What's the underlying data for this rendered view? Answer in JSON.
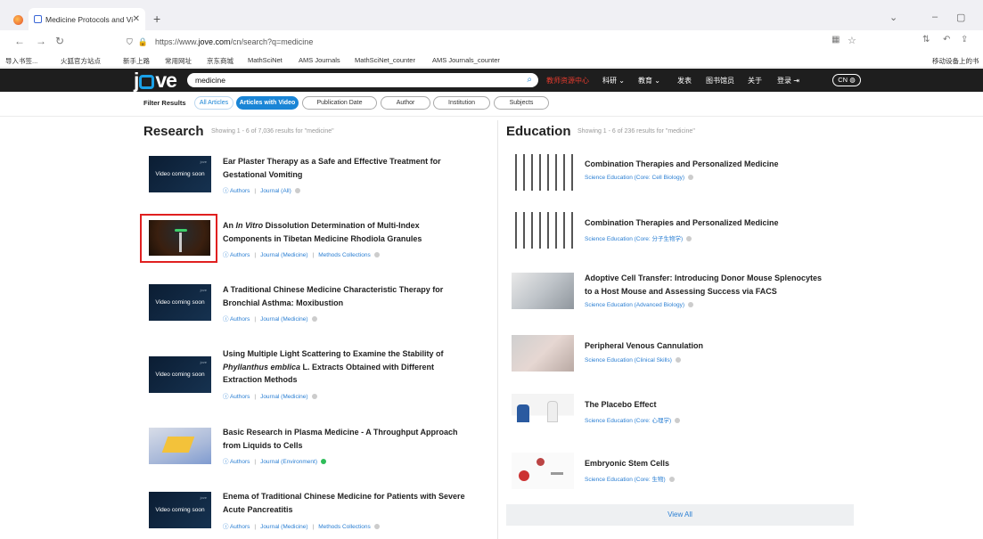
{
  "browser": {
    "tab_title": "Medicine Protocols and Vid",
    "url_prefix": "https://www.",
    "url_domain": "jove.com",
    "url_path": "/cn/search?q=medicine",
    "bookmarks": [
      "导入书签...",
      "火狐官方站点",
      "新手上路",
      "常用网址",
      "京东商城",
      "MathSciNet",
      "AMS Journals",
      "MathSciNet_counter",
      "AMS Journals_counter"
    ],
    "bookmarks_right": "移动设备上的书"
  },
  "header": {
    "logo_j": "j",
    "logo_ve": "ve",
    "search_value": "medicine",
    "nav": [
      "教师资源中心",
      "科研 ⌄",
      "教育 ⌄",
      "发表",
      "图书馆员",
      "关于",
      "登录"
    ],
    "lang": "CN"
  },
  "filters": {
    "label": "Filter Results",
    "buttons": [
      "All Articles",
      "Articles with Video",
      "Publication Date",
      "Author",
      "Institution",
      "Subjects"
    ]
  },
  "research": {
    "title": "Research",
    "subtitle": "Showing 1 - 6 of 7,036 results for \"medicine\"",
    "video_soon": "Video coming soon",
    "items": [
      {
        "title_l1": "Ear Plaster Therapy as a Safe and Effective Treatment for",
        "title_l2": "Gestational Vomiting",
        "authors": "Authors",
        "journal": "Journal (All)",
        "extra": ""
      },
      {
        "title_pre": "An ",
        "title_em": "In Vitro",
        "title_post": " Dissolution Determination of Multi-Index",
        "title_l2": "Components in Tibetan Medicine Rhodiola Granules",
        "authors": "Authors",
        "journal": "Journal (Medicine)",
        "extra": "Methods Collections"
      },
      {
        "title_l1": "A Traditional Chinese Medicine Characteristic Therapy for",
        "title_l2": "Bronchial Asthma: Moxibustion",
        "authors": "Authors",
        "journal": "Journal (Medicine)",
        "extra": ""
      },
      {
        "title_l1": "Using Multiple Light Scattering to Examine the Stability of",
        "title_em": "Phyllanthus emblica",
        "title_post": " L. Extracts Obtained with Different",
        "title_l3": "Extraction Methods",
        "authors": "Authors",
        "journal": "Journal (Medicine)",
        "extra": ""
      },
      {
        "title_l1": "Basic Research in Plasma Medicine - A Throughput Approach",
        "title_l2": "from Liquids to Cells",
        "authors": "Authors",
        "journal": "Journal (Environment)",
        "extra": ""
      },
      {
        "title_l1": "Enema of Traditional Chinese Medicine for Patients with Severe",
        "title_l2": "Acute Pancreatitis",
        "authors": "Authors",
        "journal": "Journal (Medicine)",
        "extra": "Methods Collections"
      }
    ]
  },
  "education": {
    "title": "Education",
    "subtitle": "Showing 1 - 6 of 236 results for \"medicine\"",
    "items": [
      {
        "title": "Combination Therapies and Personalized Medicine",
        "meta": "Science Education (Core: Cell Biology)"
      },
      {
        "title": "Combination Therapies and Personalized Medicine",
        "meta": "Science Education (Core: 分子生物学)"
      },
      {
        "title_l1": "Adoptive Cell Transfer: Introducing Donor Mouse Splenocytes",
        "title_l2": "to a Host Mouse and Assessing Success via FACS",
        "meta": "Science Education (Advanced Biology)"
      },
      {
        "title": "Peripheral Venous Cannulation",
        "meta": "Science Education (Clinical Skills)"
      },
      {
        "title": "The Placebo Effect",
        "meta": "Science Education (Core: 心理学)"
      },
      {
        "title": "Embryonic Stem Cells",
        "meta": "Science Education (Core: 生物)"
      }
    ],
    "view_all": "View All"
  }
}
